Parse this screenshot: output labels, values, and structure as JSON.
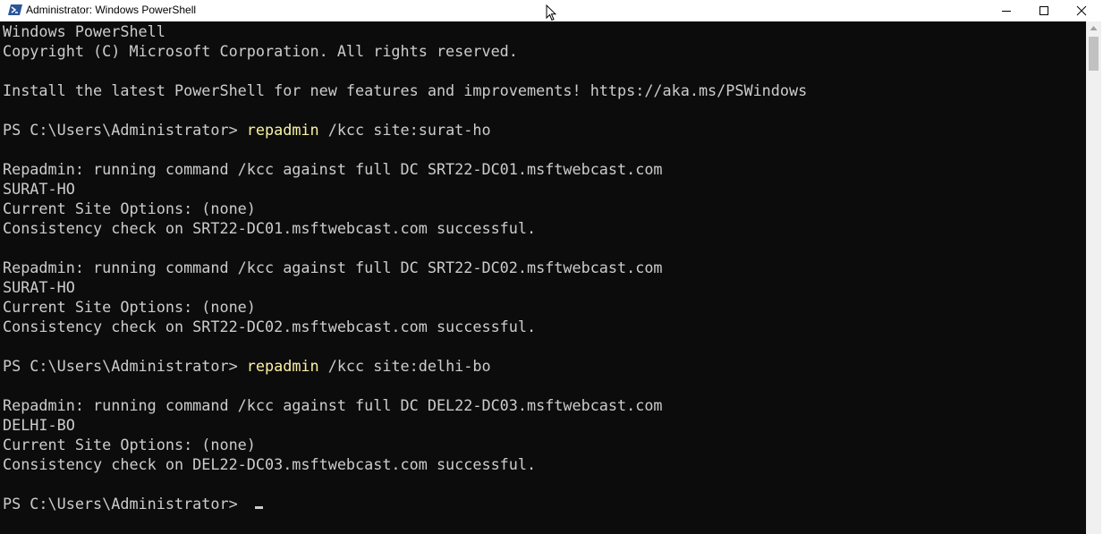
{
  "window": {
    "title": "Administrator: Windows PowerShell",
    "controls": {
      "minimize": "minimize-icon",
      "maximize": "maximize-icon",
      "close": "close-icon"
    }
  },
  "console": {
    "background": "#0c0c0c",
    "text_color": "#cccccc",
    "command_color": "#f9f1a5",
    "lines": [
      {
        "text": "Windows PowerShell"
      },
      {
        "text": "Copyright (C) Microsoft Corporation. All rights reserved."
      },
      {
        "text": ""
      },
      {
        "text": "Install the latest PowerShell for new features and improvements! https://aka.ms/PSWindows"
      },
      {
        "text": ""
      },
      {
        "prompt": "PS C:\\Users\\Administrator> ",
        "command": "repadmin",
        "args": " /kcc site:surat-ho"
      },
      {
        "text": ""
      },
      {
        "text": "Repadmin: running command /kcc against full DC SRT22-DC01.msftwebcast.com"
      },
      {
        "text": "SURAT-HO"
      },
      {
        "text": "Current Site Options: (none)"
      },
      {
        "text": "Consistency check on SRT22-DC01.msftwebcast.com successful."
      },
      {
        "text": ""
      },
      {
        "text": "Repadmin: running command /kcc against full DC SRT22-DC02.msftwebcast.com"
      },
      {
        "text": "SURAT-HO"
      },
      {
        "text": "Current Site Options: (none)"
      },
      {
        "text": "Consistency check on SRT22-DC02.msftwebcast.com successful."
      },
      {
        "text": ""
      },
      {
        "prompt": "PS C:\\Users\\Administrator> ",
        "command": "repadmin",
        "args": " /kcc site:delhi-bo"
      },
      {
        "text": ""
      },
      {
        "text": "Repadmin: running command /kcc against full DC DEL22-DC03.msftwebcast.com"
      },
      {
        "text": "DELHI-BO"
      },
      {
        "text": "Current Site Options: (none)"
      },
      {
        "text": "Consistency check on DEL22-DC03.msftwebcast.com successful."
      },
      {
        "text": ""
      },
      {
        "prompt": "PS C:\\Users\\Administrator> ",
        "cursor": true
      }
    ]
  }
}
